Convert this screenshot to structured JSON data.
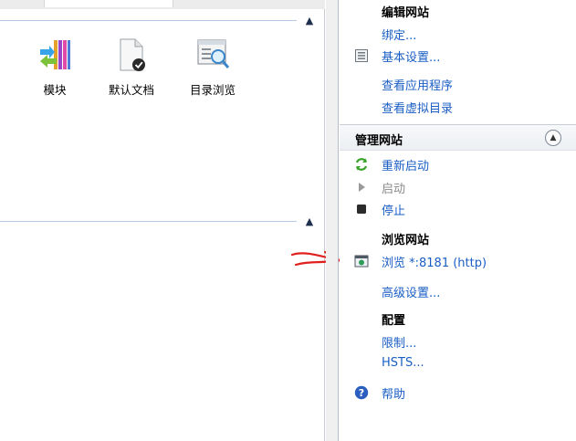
{
  "features": {
    "tiles": [
      {
        "label": "模块",
        "icon": "modules-icon"
      },
      {
        "label": "默认文档",
        "icon": "default-document-icon"
      },
      {
        "label": "目录浏览",
        "icon": "directory-browsing-icon"
      }
    ]
  },
  "actions": {
    "edit_site": {
      "title": "编辑网站",
      "bindings": "绑定...",
      "basic_settings": "基本设置...",
      "view_applications": "查看应用程序",
      "view_virtual_dirs": "查看虚拟目录"
    },
    "manage_site": {
      "title": "管理网站",
      "restart": "重新启动",
      "start": "启动",
      "stop": "停止",
      "browse_title": "浏览网站",
      "browse_link": "浏览 *:8181 (http)",
      "advanced": "高级设置...",
      "config_title": "配置",
      "limits": "限制...",
      "hsts": "HSTS..."
    },
    "help": "帮助"
  },
  "colors": {
    "link": "#1a5ec4",
    "disabled": "#8a8a8a",
    "annotation": "#e0201c"
  }
}
